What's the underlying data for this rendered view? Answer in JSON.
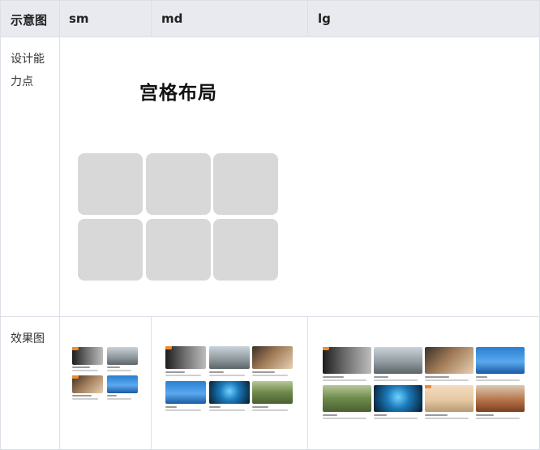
{
  "table": {
    "headers": {
      "diagram": "示意图",
      "sm": "sm",
      "md": "md",
      "lg": "lg"
    },
    "rows": {
      "design_point": "设计能力点",
      "effect": "效果图"
    }
  },
  "diagram": {
    "title": "宫格布局"
  },
  "colors": {
    "header_bg": "#e8eaef",
    "border": "#dcdfe6",
    "placeholder": "#d8d8d8",
    "tag": "#f28a2e"
  }
}
